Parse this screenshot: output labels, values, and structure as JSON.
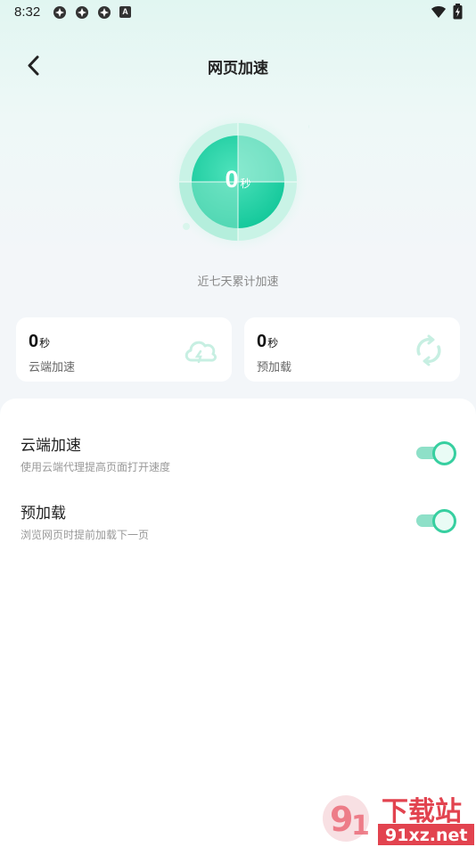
{
  "status_bar": {
    "time": "8:32",
    "notification_badge": "A"
  },
  "header": {
    "title": "网页加速"
  },
  "gauge": {
    "value": "0",
    "unit": "秒",
    "caption": "近七天累计加速"
  },
  "cards": [
    {
      "value": "0",
      "unit": "秒",
      "label": "云端加速",
      "icon": "cloud-icon"
    },
    {
      "value": "0",
      "unit": "秒",
      "label": "预加载",
      "icon": "refresh-icon"
    }
  ],
  "settings": [
    {
      "title": "云端加速",
      "subtitle": "使用云端代理提高页面打开速度",
      "enabled": true
    },
    {
      "title": "预加载",
      "subtitle": "浏览网页时提前加载下一页",
      "enabled": true
    }
  ],
  "watermark": {
    "brand": "下载站",
    "site": "91xz.net"
  },
  "colors": {
    "accent": "#37cfa0",
    "accent_light": "#8ee0c8",
    "gauge_dark": "#1ed5a6",
    "background": "#f3f6f9"
  }
}
